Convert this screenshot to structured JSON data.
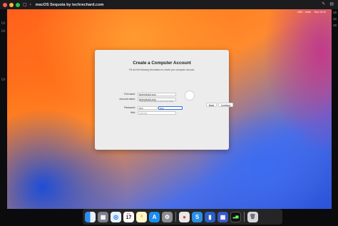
{
  "host": {
    "window_title": "macOS Sequoia by techrechard.com",
    "right_icons": [
      "sidebar-icon",
      "search-icon",
      "share-icon",
      "display-icon"
    ]
  },
  "left_strip": {
    "items": [
      "Ur",
      "Ur",
      "Ur"
    ]
  },
  "right_strip": {
    "dates": [
      "15",
      "22",
      "29"
    ]
  },
  "vm_menubar": {
    "items": [
      "ABC - India",
      "Sun 10:41"
    ]
  },
  "setup": {
    "title": "Create a Computer Account",
    "subtitle": "Fill out the following information to create your computer account.",
    "fields": [
      {
        "label": "Full name:",
        "value": "techrechard.com"
      },
      {
        "label": "Account name:",
        "value": "techrechard.com"
      },
      {
        "label": "Password:",
        "value": "•••••",
        "verify_value": "•••••"
      },
      {
        "label": "Hint:",
        "placeholder": "optional"
      }
    ],
    "account_hint": "This will be the name of your home folder.",
    "buttons": {
      "back": "Back",
      "continue": "Continue"
    }
  },
  "dock": {
    "calendar_month": "JUL",
    "calendar_day": "17",
    "apps": [
      "Finder",
      "Launchpad",
      "Safari",
      "Calendar",
      "Notes",
      "App Store",
      "System Settings",
      "Chrome",
      "Setapp",
      "VMware",
      "Grid",
      "Activity Monitor",
      "Trash"
    ]
  }
}
